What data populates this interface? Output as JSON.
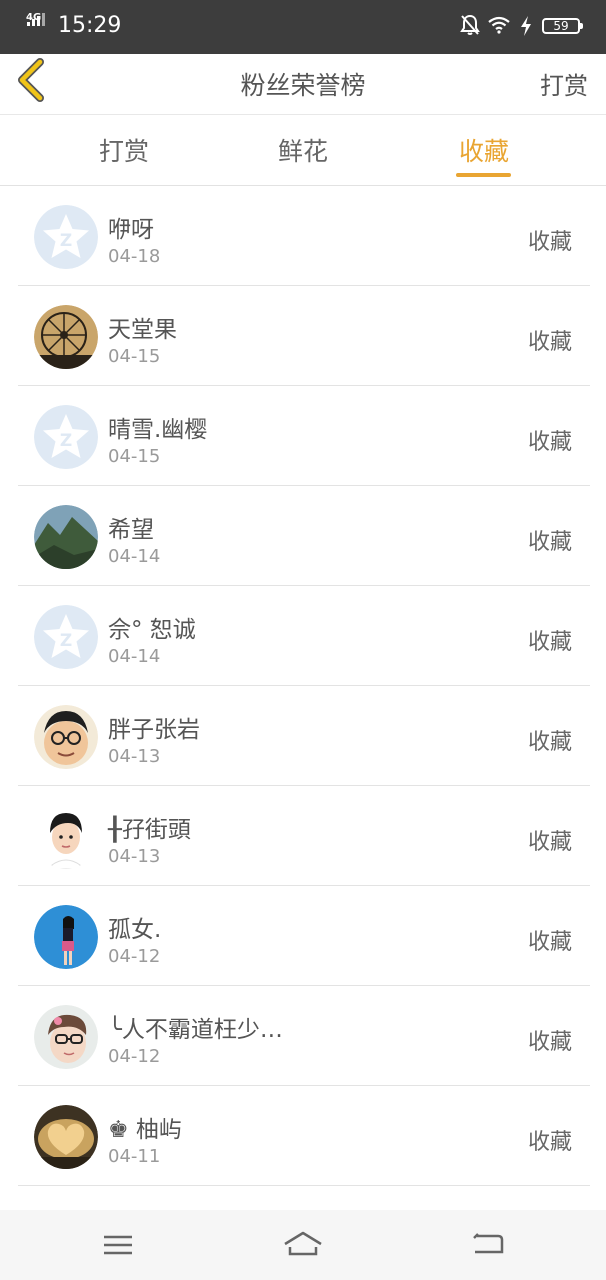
{
  "status_bar": {
    "network": "4G",
    "time": "15:29",
    "battery": "59",
    "icons": [
      "signal-icon",
      "bell-mute-icon",
      "wifi-icon",
      "charging-icon",
      "battery-icon"
    ]
  },
  "header": {
    "back_icon": "chevron-left-icon",
    "title": "粉丝荣誉榜",
    "right_link": "打赏"
  },
  "tabs": [
    {
      "label": "打赏",
      "active": false
    },
    {
      "label": "鲜花",
      "active": false
    },
    {
      "label": "收藏",
      "active": true
    }
  ],
  "colors": {
    "accent": "#e9a532",
    "back_icon": "#f0c419",
    "status_bar_bg": "#3d3d3d"
  },
  "list": [
    {
      "name": "咿呀",
      "date": "04-18",
      "action": "收藏",
      "avatar": "default-qq-avatar"
    },
    {
      "name": "天堂果",
      "date": "04-15",
      "action": "收藏",
      "avatar": "ferris-wheel-avatar"
    },
    {
      "name": "晴雪.幽樱",
      "date": "04-15",
      "action": "收藏",
      "avatar": "default-qq-avatar"
    },
    {
      "name": "希望",
      "date": "04-14",
      "action": "收藏",
      "avatar": "landscape-avatar"
    },
    {
      "name": "佘° 恕诚",
      "date": "04-14",
      "action": "收藏",
      "avatar": "default-qq-avatar"
    },
    {
      "name": "胖子张岩",
      "date": "04-13",
      "action": "收藏",
      "avatar": "cartoon-man-avatar"
    },
    {
      "name": "╂孖街頭",
      "date": "04-13",
      "action": "收藏",
      "avatar": "cartoon-boy-avatar"
    },
    {
      "name": "孤女.",
      "date": "04-12",
      "action": "收藏",
      "avatar": "girl-blue-avatar"
    },
    {
      "name": "╰人不霸道枉少…",
      "date": "04-12",
      "action": "收藏",
      "avatar": "glasses-child-avatar"
    },
    {
      "name": "♚ 柚屿",
      "date": "04-11",
      "action": "收藏",
      "avatar": "heart-avatar"
    }
  ],
  "nav_bar": {
    "icons": [
      "menu-icon",
      "home-icon",
      "back-icon"
    ]
  }
}
